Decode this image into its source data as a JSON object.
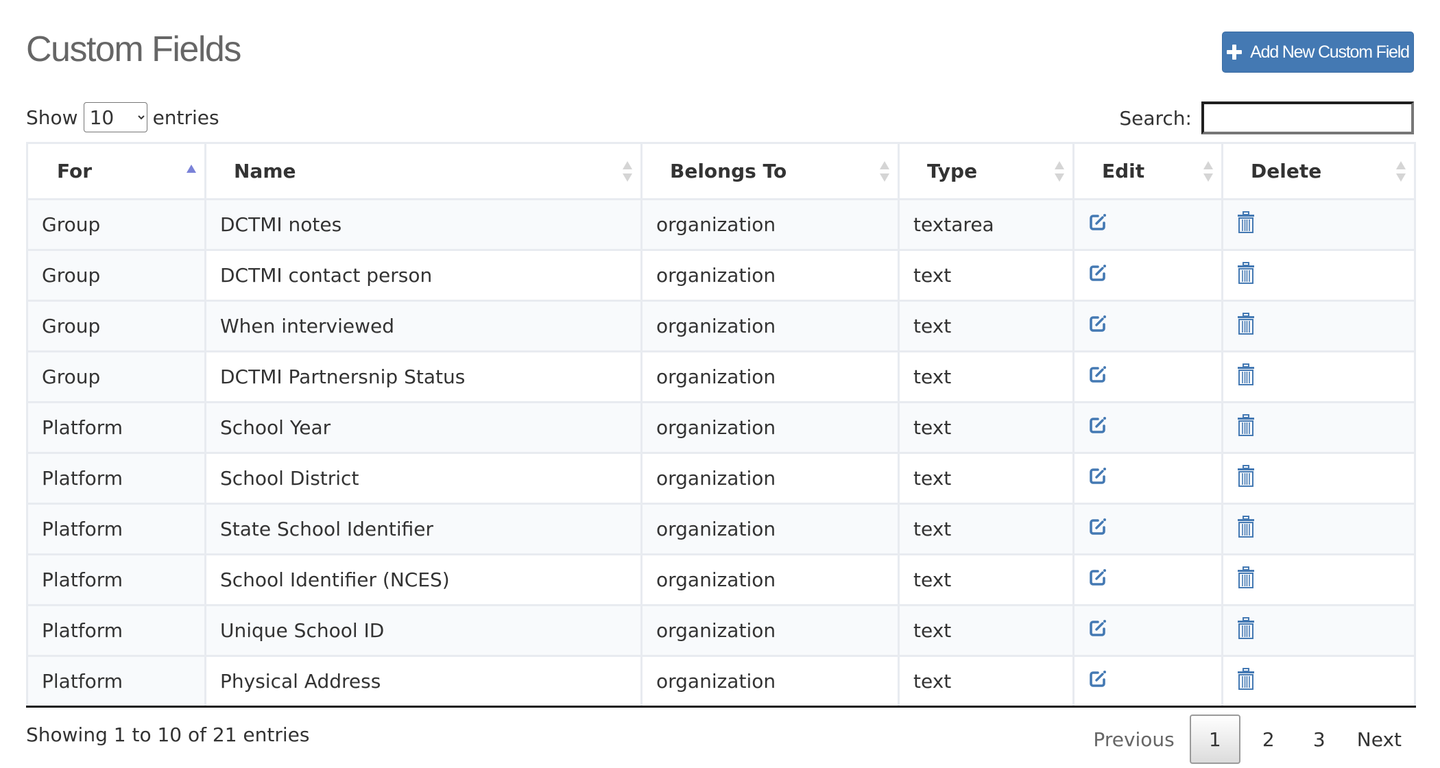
{
  "page": {
    "title": "Custom Fields",
    "add_button_label": "Add New Custom Field"
  },
  "length_control": {
    "prefix": "Show",
    "selected": "10",
    "suffix": "entries"
  },
  "search": {
    "label": "Search:",
    "value": "",
    "placeholder": ""
  },
  "table": {
    "columns": [
      {
        "label": "For",
        "sort": "asc"
      },
      {
        "label": "Name",
        "sort": "both"
      },
      {
        "label": "Belongs To",
        "sort": "both"
      },
      {
        "label": "Type",
        "sort": "both"
      },
      {
        "label": "Edit",
        "sort": "both"
      },
      {
        "label": "Delete",
        "sort": "both"
      }
    ],
    "rows": [
      {
        "for": "Group",
        "name": "DCTMI notes",
        "belongs_to": "organization",
        "type": "textarea"
      },
      {
        "for": "Group",
        "name": "DCTMI contact person",
        "belongs_to": "organization",
        "type": "text"
      },
      {
        "for": "Group",
        "name": "When interviewed",
        "belongs_to": "organization",
        "type": "text"
      },
      {
        "for": "Group",
        "name": "DCTMI Partnersnip Status",
        "belongs_to": "organization",
        "type": "text"
      },
      {
        "for": "Platform",
        "name": "School Year",
        "belongs_to": "organization",
        "type": "text"
      },
      {
        "for": "Platform",
        "name": "School District",
        "belongs_to": "organization",
        "type": "text"
      },
      {
        "for": "Platform",
        "name": "State School Identifier",
        "belongs_to": "organization",
        "type": "text"
      },
      {
        "for": "Platform",
        "name": "School Identifier (NCES)",
        "belongs_to": "organization",
        "type": "text"
      },
      {
        "for": "Platform",
        "name": "Unique School ID",
        "belongs_to": "organization",
        "type": "text"
      },
      {
        "for": "Platform",
        "name": "Physical Address",
        "belongs_to": "organization",
        "type": "text"
      }
    ],
    "edit_icon": "edit-icon",
    "delete_icon": "trash-icon"
  },
  "footer": {
    "info": "Showing 1 to 10 of 21 entries",
    "previous_label": "Previous",
    "pages": [
      "1",
      "2",
      "3"
    ],
    "current_page": "1",
    "next_label": "Next"
  },
  "colors": {
    "accent": "#4479b3",
    "icon": "#4479b3",
    "sort_active": "#7a82d8",
    "stripe": "#f8fafc",
    "border": "#e8ebf0"
  }
}
